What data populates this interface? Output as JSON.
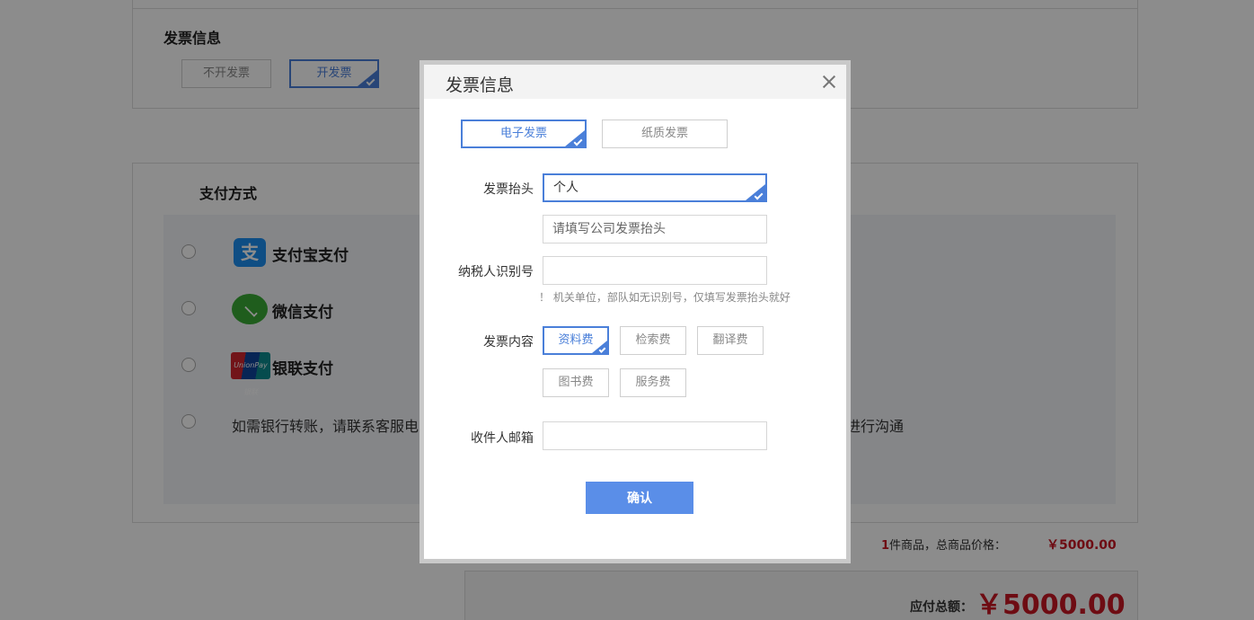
{
  "invoice_section": {
    "title": "发票信息",
    "options": [
      "不开发票",
      "开发票"
    ],
    "selected": "开发票"
  },
  "payment_section": {
    "title": "支付方式",
    "methods": [
      {
        "label": "支付宝支付",
        "icon": "alipay-icon"
      },
      {
        "label": "微信支付",
        "icon": "wechat-icon"
      },
      {
        "label": "银联支付",
        "icon": "unionpay-icon"
      }
    ],
    "bank_transfer_note_left": "如需银行转账，请联系客服电",
    "bank_transfer_note_right": "进行沟通",
    "unionpay_logo_text": "UnionPay 银联"
  },
  "summary": {
    "count": "1",
    "count_suffix": "件商品，总商品价格：",
    "subtotal": "￥5000.00",
    "total_label": "应付总额：",
    "total": "￥5000.00"
  },
  "modal": {
    "title": "发票信息",
    "type_options": [
      "电子发票",
      "纸质发票"
    ],
    "type_selected": "电子发票",
    "header_label": "发票抬头",
    "header_value": "个人",
    "company_placeholder": "请填写公司发票抬头",
    "taxpayer_label": "纳税人识别号",
    "taxpayer_hint": "！ 机关单位，部队如无识别号，仅填写发票抬头就好",
    "content_label": "发票内容",
    "content_options": [
      "资料费",
      "检索费",
      "翻译费",
      "图书费",
      "服务费"
    ],
    "content_selected": "资料费",
    "email_label": "收件人邮箱",
    "confirm_label": "确认"
  },
  "colors": {
    "accent": "#4a7fd9",
    "confirm": "#5a8ee8",
    "price_red": "#c81623"
  }
}
